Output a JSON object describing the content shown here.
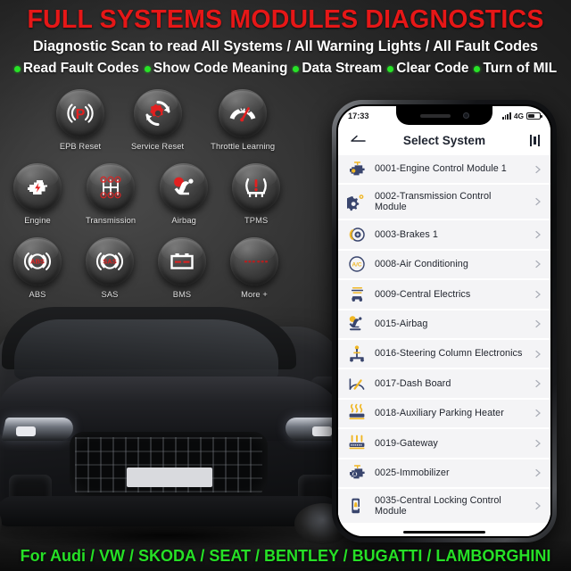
{
  "header": {
    "title": "FULL SYSTEMS MODULES DIAGNOSTICS",
    "subtitle": "Diagnostic Scan to read All Systems / All Warning Lights / All Fault Codes",
    "features": [
      "Read Fault Codes",
      "Show Code Meaning",
      "Data Stream",
      "Clear Code",
      "Turn of MIL"
    ],
    "title_color": "#e61717",
    "bullet_color": "#27e327"
  },
  "functions": {
    "row1": [
      {
        "label": "EPB Reset",
        "icon": "epb-brake-icon"
      },
      {
        "label": "Service Reset",
        "icon": "service-wrench-icon"
      },
      {
        "label": "Throttle Learning",
        "icon": "throttle-gauge-icon"
      }
    ],
    "row2": [
      {
        "label": "Engine",
        "icon": "engine-icon"
      },
      {
        "label": "Transmission",
        "icon": "transmission-gearstick-icon"
      },
      {
        "label": "Airbag",
        "icon": "airbag-seat-icon"
      },
      {
        "label": "TPMS",
        "icon": "tpms-tire-icon"
      }
    ],
    "row3": [
      {
        "label": "ABS",
        "icon": "abs-brake-icon"
      },
      {
        "label": "SAS",
        "icon": "sas-steering-icon"
      },
      {
        "label": "BMS",
        "icon": "bms-battery-icon"
      },
      {
        "label": "More +",
        "icon": "more-dots-icon"
      }
    ]
  },
  "phone": {
    "status": {
      "time": "17:33",
      "network": "4G"
    },
    "nav": {
      "back": "back-arrow",
      "title": "Select System",
      "menu": "menu-bars"
    },
    "systems": [
      {
        "label": "0001-Engine Control Module 1",
        "icon": "engine-module-icon",
        "tall": false
      },
      {
        "label": "0002-Transmission Control Module",
        "icon": "gear-module-icon",
        "tall": true
      },
      {
        "label": "0003-Brakes 1",
        "icon": "brake-disc-icon",
        "tall": false
      },
      {
        "label": "0008-Air Conditioning",
        "icon": "ac-icon",
        "tall": false
      },
      {
        "label": "0009-Central Electrics",
        "icon": "central-electrics-icon",
        "tall": false
      },
      {
        "label": "0015-Airbag",
        "icon": "airbag-seat-icon",
        "tall": false
      },
      {
        "label": "0016-Steering Column Electronics",
        "icon": "steering-column-icon",
        "tall": false
      },
      {
        "label": "0017-Dash Board",
        "icon": "dashboard-gauge-icon",
        "tall": false
      },
      {
        "label": "0018-Auxiliary Parking Heater",
        "icon": "heater-icon",
        "tall": false
      },
      {
        "label": "0019-Gateway",
        "icon": "gateway-icon",
        "tall": false
      },
      {
        "label": "0025-Immobilizer",
        "icon": "immobilizer-icon",
        "tall": false
      },
      {
        "label": "0035-Central Locking Control Module",
        "icon": "central-locking-icon",
        "tall": true
      }
    ]
  },
  "footer": {
    "text": "For Audi / VW / SKODA / SEAT / BENTLEY / BUGATTI / LAMBORGHINI",
    "color": "#26e026"
  }
}
